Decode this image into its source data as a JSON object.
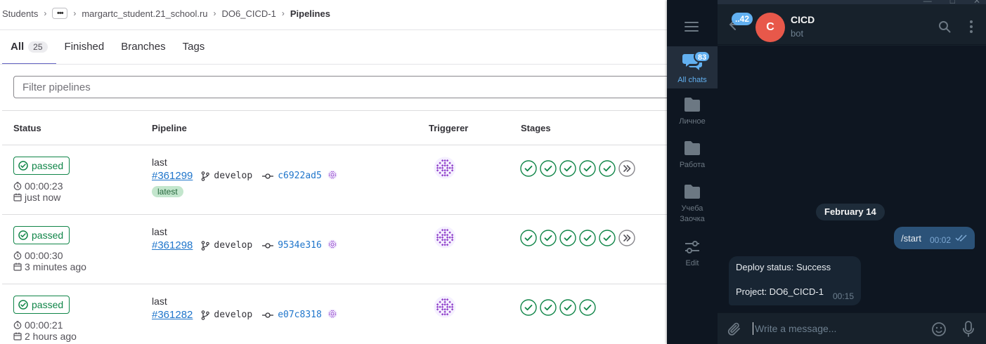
{
  "breadcrumbs": {
    "items": [
      "Students",
      "margartc_student.21_school.ru",
      "DO6_CICD-1"
    ],
    "more": "•••",
    "current": "Pipelines",
    "sep": "›"
  },
  "tabs": [
    {
      "label": "All",
      "count": "25"
    },
    {
      "label": "Finished"
    },
    {
      "label": "Branches"
    },
    {
      "label": "Tags"
    }
  ],
  "filter": {
    "placeholder": "Filter pipelines"
  },
  "table": {
    "headers": [
      "Status",
      "Pipeline",
      "Triggerer",
      "Stages"
    ],
    "rows": [
      {
        "status": "passed",
        "duration": "00:00:23",
        "ago": "just now",
        "name": "last",
        "id": "#361299",
        "branch": "develop",
        "sha": "c6922ad5",
        "latest": "latest",
        "stages": 5,
        "has_more": true
      },
      {
        "status": "passed",
        "duration": "00:00:30",
        "ago": "3 minutes ago",
        "name": "last",
        "id": "#361298",
        "branch": "develop",
        "sha": "9534e316",
        "latest": null,
        "stages": 5,
        "has_more": true
      },
      {
        "status": "passed",
        "duration": "00:00:21",
        "ago": "2 hours ago",
        "name": "last",
        "id": "#361282",
        "branch": "develop",
        "sha": "e07c8318",
        "latest": null,
        "stages": 4,
        "has_more": false
      }
    ]
  },
  "telegram": {
    "folders": [
      {
        "label": "All chats",
        "unread": "83",
        "active": true,
        "icon": "chats-icon"
      },
      {
        "label": "Личное",
        "icon": "folder-icon"
      },
      {
        "label": "Работа",
        "icon": "folder-icon"
      },
      {
        "label": "Учеба\nЗаочка",
        "icon": "folder-icon"
      },
      {
        "label": "Edit",
        "icon": "edit-folders-icon"
      }
    ],
    "back_badge": "..42",
    "chat": {
      "avatar_letter": "C",
      "title": "CICD",
      "subtitle": "bot",
      "avatar_color": "#e8584a"
    },
    "date": "February 14",
    "outgoing": {
      "text": "/start",
      "time": "00:02"
    },
    "incoming": {
      "line1": "Deploy status: Success",
      "line2": "Project: DO6_CICD-1",
      "time": "00:15"
    },
    "compose_placeholder": "Write a message..."
  },
  "colors": {
    "success": "#108548",
    "link": "#1f75cb",
    "tab_underline": "#6666c4",
    "tg_accent": "#62b0f0",
    "tg_bg": "#0e1621",
    "tg_panel": "#17212b",
    "tg_bubble_out": "#2b5278",
    "tg_bubble_in": "#182533"
  }
}
